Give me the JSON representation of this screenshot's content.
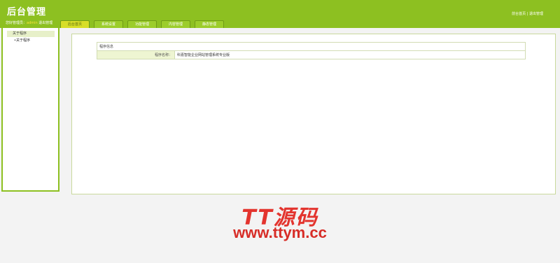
{
  "header": {
    "title": "后台管理",
    "user_prefix": "您好管理员：",
    "username": "admin",
    "logout_label": "退出管理",
    "top_links": "前台首页 | 退出管理"
  },
  "tabs": [
    {
      "label": "后台首页"
    },
    {
      "label": "系统设置"
    },
    {
      "label": "功能管理"
    },
    {
      "label": "内容管理"
    },
    {
      "label": "静态管理"
    }
  ],
  "sidebar": {
    "category": "关于程序",
    "items": [
      {
        "label": "•关于程序"
      }
    ]
  },
  "panel": {
    "caption": "程序信息",
    "rows": [
      {
        "label": "程序名称：",
        "value": "科嘉智能企业网站管理系统专业版"
      }
    ]
  },
  "watermark": {
    "title": "TT源码",
    "url": "www.ttym.cc"
  },
  "colors": {
    "header_green": "#8dc021",
    "active_tab": "#d7de28",
    "watermark_red": "#e3342e"
  }
}
